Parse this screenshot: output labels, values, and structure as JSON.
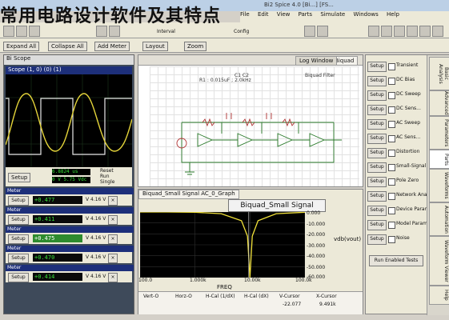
{
  "caption": "常用电路设计软件及其特点",
  "window": {
    "title": "Bi2 Spice 4.0 [Bi...] [FS..."
  },
  "menu": [
    "File",
    "Edit",
    "View",
    "Parts",
    "Simulate",
    "Windows",
    "Help"
  ],
  "toolbar": {
    "interval_label": "Interval",
    "config_label": "Config"
  },
  "toolbar2": {
    "expand": "Expand All",
    "collapse": "Collapse All",
    "add_meter": "Add Meter",
    "layout": "Layout",
    "zoom": "Zoom"
  },
  "scope": {
    "tab": "Bi Scope",
    "title": "Scope (1, 0) (0) (1)",
    "setup": "Setup",
    "readout": "6.8824 us",
    "readout2": "0 V 5.75 Vdc",
    "reset": "Reset",
    "run": "Run",
    "single": "Single"
  },
  "meters": [
    {
      "title": "Meter",
      "value": "+0.477",
      "unit": "V 4.16 V"
    },
    {
      "title": "Meter",
      "value": "+0.411",
      "unit": "V 4.16 V"
    },
    {
      "title": "Meter",
      "value": "+0.475",
      "unit": "V 4.16 V"
    },
    {
      "title": "Meter",
      "value": "+0.470",
      "unit": "V 4.16 V"
    },
    {
      "title": "Meter",
      "value": "+0.414",
      "unit": "V 4.16 V"
    }
  ],
  "schematic": {
    "tabs": [
      "Biquad",
      "Log Window"
    ],
    "note_left": "Biquad Filter",
    "note_mid": "R1 : 0.015uF ; 2.0kHz",
    "note_right": "C1 C2"
  },
  "graph": {
    "tab": "Biquad_Small Signal AC_0_Graph",
    "title": "Biquad_Small Signal AC_0_Graph",
    "y_ticks": [
      "0.000",
      "-10.000",
      "-20.000",
      "-30.000",
      "-40.000",
      "-50.000",
      "-60.000"
    ],
    "y_label": "vdb(vout)",
    "x_ticks": [
      "100.0",
      "1.000k",
      "10.00k",
      "100.0k"
    ],
    "x_label": "FREQ",
    "cursor_headers": [
      "Vert-O",
      "Horz-O",
      "H-Cal (1/dX)",
      "H-Cal (dX)",
      "V-Cursor",
      "X-Cursor"
    ],
    "cursor_values": [
      "",
      "",
      "",
      "",
      "-22.077",
      "9.491k"
    ]
  },
  "analyses": {
    "items": [
      "Transient",
      "DC Bias",
      "DC Sweep",
      "DC Sens...",
      "AC Sweep",
      "AC Sens...",
      "Distortion",
      "Small-Signal T.F.",
      "Pole Zero",
      "Network Analysis",
      "Device Param...",
      "Model Param...",
      "Noise"
    ],
    "setup_label": "Setup",
    "run_enabled": "Run Enabled Tests",
    "vtabs": [
      "Basic Analysis",
      "Advanced",
      "Parameters",
      "Parts",
      "Waveforms",
      "Automation",
      "Waveform Viewer",
      "Help"
    ]
  },
  "chart_data": {
    "type": "line",
    "title": "Biquad_Small Signal AC_0_Graph",
    "xlabel": "FREQ",
    "ylabel": "vdb(vout)",
    "x_scale": "log",
    "xlim": [
      100,
      100000
    ],
    "ylim": [
      -60,
      0
    ],
    "series": [
      {
        "x": [
          100,
          300,
          1000,
          3000,
          7000,
          9000,
          10000,
          11000,
          14000,
          30000,
          100000
        ],
        "y": [
          0,
          0,
          -0.2,
          -1.5,
          -8,
          -22,
          -60,
          -22,
          -8,
          -1.5,
          -0.2
        ]
      }
    ]
  }
}
